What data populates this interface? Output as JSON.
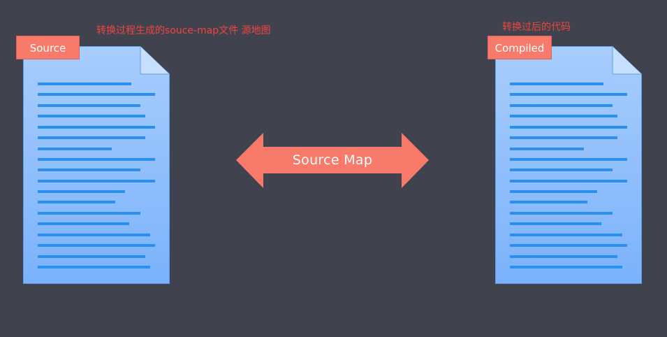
{
  "source_doc": {
    "tag_label": "Source",
    "annotation": "转换过程生成的souce-map文件 源地图"
  },
  "compiled_doc": {
    "tag_label": "Compiled",
    "annotation": "转换过后的代码"
  },
  "arrow": {
    "label": "Source Map"
  },
  "colors": {
    "background": "#40434d",
    "tag_fill": "#f77a6a",
    "annotation_text": "#f0453e",
    "doc_top": "#a8cdfd",
    "doc_bottom": "#7bb2fb",
    "doc_lines": "#2b8ff0",
    "arrow_fill": "#f77a6a"
  },
  "icons": {
    "source_document": "document-icon",
    "compiled_document": "document-icon",
    "arrow": "double-arrow-icon"
  }
}
